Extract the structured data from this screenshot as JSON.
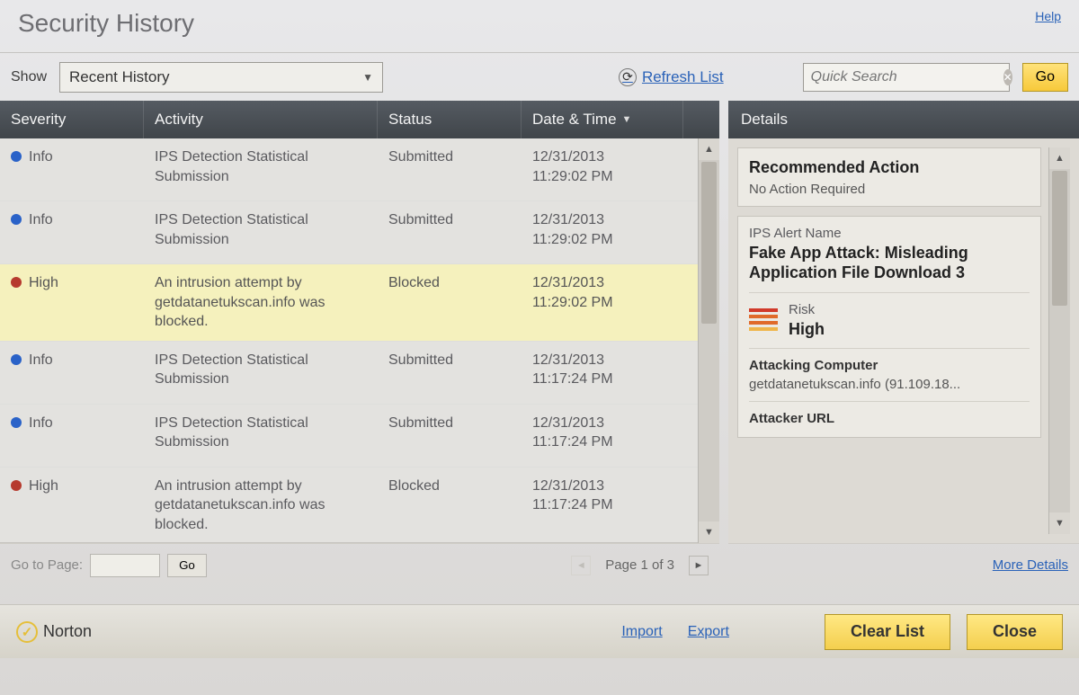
{
  "title": "Security History",
  "help": "Help",
  "toolbar": {
    "show_label": "Show",
    "dropdown_value": "Recent History",
    "refresh_label": "Refresh List",
    "search_placeholder": "Quick Search",
    "go_label": "Go"
  },
  "columns": {
    "severity": "Severity",
    "activity": "Activity",
    "status": "Status",
    "datetime": "Date & Time"
  },
  "rows": [
    {
      "severity": "Info",
      "level": "info",
      "activity": "IPS Detection Statistical Submission",
      "status": "Submitted",
      "date": "12/31/2013",
      "time": "11:29:02 PM",
      "selected": false
    },
    {
      "severity": "Info",
      "level": "info",
      "activity": "IPS Detection Statistical Submission",
      "status": "Submitted",
      "date": "12/31/2013",
      "time": "11:29:02 PM",
      "selected": false
    },
    {
      "severity": "High",
      "level": "high",
      "activity": "An intrusion attempt by getdatanetukscan.info was blocked.",
      "status": "Blocked",
      "date": "12/31/2013",
      "time": "11:29:02 PM",
      "selected": true
    },
    {
      "severity": "Info",
      "level": "info",
      "activity": "IPS Detection Statistical Submission",
      "status": "Submitted",
      "date": "12/31/2013",
      "time": "11:17:24 PM",
      "selected": false
    },
    {
      "severity": "Info",
      "level": "info",
      "activity": "IPS Detection Statistical Submission",
      "status": "Submitted",
      "date": "12/31/2013",
      "time": "11:17:24 PM",
      "selected": false
    },
    {
      "severity": "High",
      "level": "high",
      "activity": "An intrusion attempt by getdatanetukscan.info was blocked.",
      "status": "Blocked",
      "date": "12/31/2013",
      "time": "11:17:24 PM",
      "selected": false
    }
  ],
  "pager": {
    "goto_label": "Go to Page:",
    "go_label": "Go",
    "page_text": "Page 1 of 3"
  },
  "details": {
    "header": "Details",
    "rec_action_label": "Recommended Action",
    "rec_action_value": "No Action Required",
    "alert_name_label": "IPS Alert Name",
    "alert_name_value": "Fake App Attack: Misleading Application File Download 3",
    "risk_label": "Risk",
    "risk_value": "High",
    "attacking_label": "Attacking Computer",
    "attacking_value": "getdatanetukscan.info (91.109.18...",
    "attacker_url_label": "Attacker URL",
    "more_details": "More Details"
  },
  "footer": {
    "brand": "Norton",
    "import": "Import",
    "export": "Export",
    "clear": "Clear List",
    "close": "Close"
  }
}
